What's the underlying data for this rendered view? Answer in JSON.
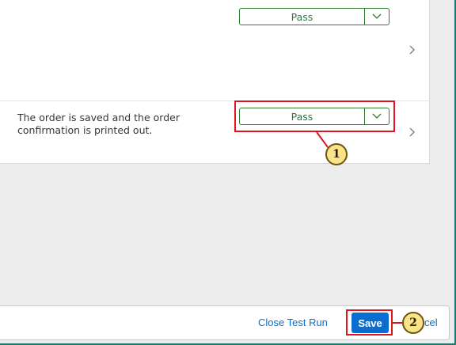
{
  "steps": [
    {
      "result": {
        "value": "Pass",
        "arrow_icon": "chevron-down-icon"
      },
      "nav_icon": "chevron-right-icon"
    },
    {
      "expected_text": "The order is saved and the order confirmation is printed out.",
      "result": {
        "value": "Pass",
        "arrow_icon": "chevron-down-icon"
      },
      "nav_icon": "chevron-right-icon"
    }
  ],
  "footer": {
    "close_test_run_label": "Close Test Run",
    "save_label": "Save",
    "cancel_label_visible": "cel"
  },
  "callouts": [
    {
      "number": "1",
      "target": "step-2-result-select"
    },
    {
      "number": "2",
      "target": "save-button"
    }
  ],
  "colors": {
    "highlight": "#e0141e",
    "callout_fill": "#fbe38a",
    "select_border": "#2e7d32",
    "pass_text": "#2b7a3a",
    "primary_button": "#0a6ed1",
    "link": "#0a6ed1"
  }
}
